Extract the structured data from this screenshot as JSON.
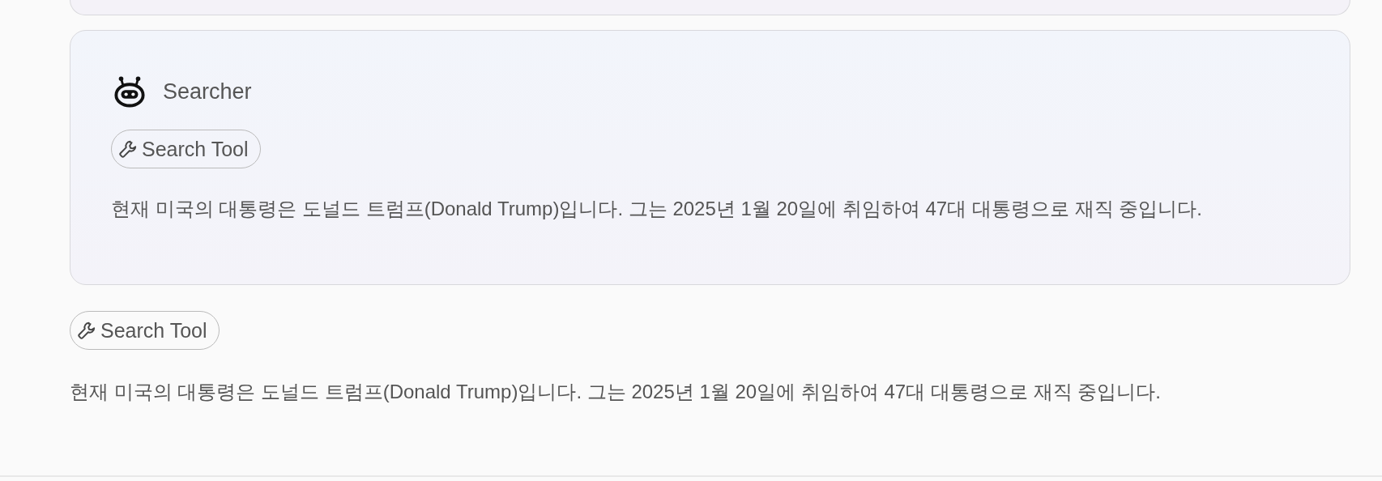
{
  "previous_card": {
    "visible": true
  },
  "agent_card": {
    "agent_name": "Searcher",
    "tool_chip": "Search Tool",
    "message": "현재 미국의 대통령은 도널드 트럼프(Donald Trump)입니다. 그는 2025년 1월 20일에 취임하여 47대 대통령으로 재직 중입니다."
  },
  "final_answer": {
    "tool_chip": "Search Tool",
    "message": "현재 미국의 대통령은 도널드 트럼프(Donald Trump)입니다. 그는 2025년 1월 20일에 취임하여 47대 대통령으로 재직 중입니다."
  }
}
